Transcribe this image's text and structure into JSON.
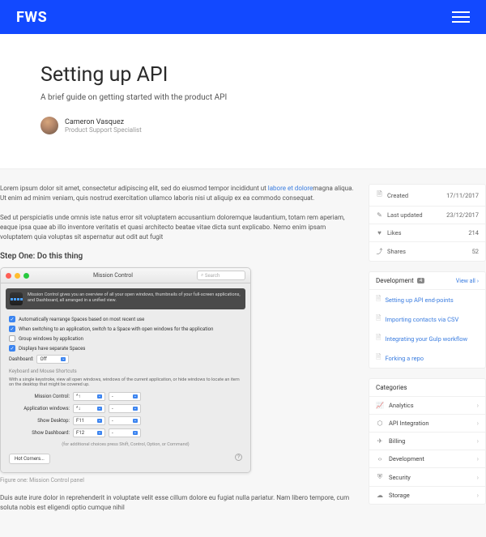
{
  "header": {
    "logo": "FWS"
  },
  "article": {
    "title": "Setting up API",
    "subtitle": "A brief guide on getting started with the product API",
    "author_name": "Cameron Vasquez",
    "author_role": "Product Support Specialist",
    "para1_a": "Lorem ipsum dolor sit amet, consectetur adipiscing elit, sed do eiusmod tempor incididunt ut ",
    "para1_link": "labore et dolore",
    "para1_b": "magna aliqua. Ut enim ad minim veniam, quis nostrud exercitation ullamco laboris nisi ut aliquip ex ea commodo consequat.",
    "para2": "Sed ut perspiciatis unde omnis iste natus error sit voluptatem accusantium doloremque laudantium, totam rem aperiam, eaque ipsa quae ab illo inventore veritatis et quasi architecto beatae vitae dicta sunt explicabo. Nemo enim ipsam voluptatem quia voluptas sit aspernatur aut odit aut fugit",
    "step_heading": "Step One: Do this thing",
    "caption": "Figure one: Mission Control panel",
    "para3": "Duis aute irure dolor in reprehenderit in voluptate velit esse cillum dolore eu fugiat nulla pariatur. Nam libero tempore, cum soluta nobis est eligendi optio cumque nihil"
  },
  "mac": {
    "title": "Mission Control",
    "search_placeholder": "Search",
    "desc": "Mission Control gives you an overview of all your open windows, thumbnails of your full-screen applications, and Dashboard, all arranged in a unified view.",
    "opt1": "Automatically rearrange Spaces based on most recent use",
    "opt2": "When switching to an application, switch to a Space with open windows for the application",
    "opt3": "Group windows by application",
    "opt4": "Displays have separate Spaces",
    "dash_label": "Dashboard:",
    "dash_value": "Off",
    "shortcuts_label": "Keyboard and Mouse Shortcuts",
    "shortcuts_note": "With a single keystroke, view all open windows, windows of the current application, or hide windows to locate an item on the desktop that might be covered up.",
    "r1_label": "Mission Control:",
    "r1_val": "^↑",
    "r2_label": "Application windows:",
    "r2_val": "^↓",
    "r3_label": "Show Desktop:",
    "r3_val": "F11",
    "r4_label": "Show Dashboard:",
    "r4_val": "F12",
    "foot_note": "(for additional choices press Shift, Control, Option, or Command)",
    "hot_corners": "Hot Corners..."
  },
  "meta": {
    "created_label": "Created",
    "created_val": "17/11/2017",
    "updated_label": "Last updated",
    "updated_val": "23/12/2017",
    "likes_label": "Likes",
    "likes_val": "214",
    "shares_label": "Shares",
    "shares_val": "52"
  },
  "related": {
    "heading": "Development",
    "badge": "4",
    "view_all": "View all",
    "items": [
      "Setting up API end-points",
      "Importing contacts via CSV",
      "Integrating your Gulp workflow",
      "Forking a repo"
    ]
  },
  "categories": {
    "heading": "Categories",
    "items": [
      {
        "icon": "📈",
        "label": "Analytics"
      },
      {
        "icon": "⬡",
        "label": "API Integration"
      },
      {
        "icon": "✈",
        "label": "Billing"
      },
      {
        "icon": "‹›",
        "label": "Development"
      },
      {
        "icon": "⛨",
        "label": "Security"
      },
      {
        "icon": "☁",
        "label": "Storage"
      }
    ]
  }
}
